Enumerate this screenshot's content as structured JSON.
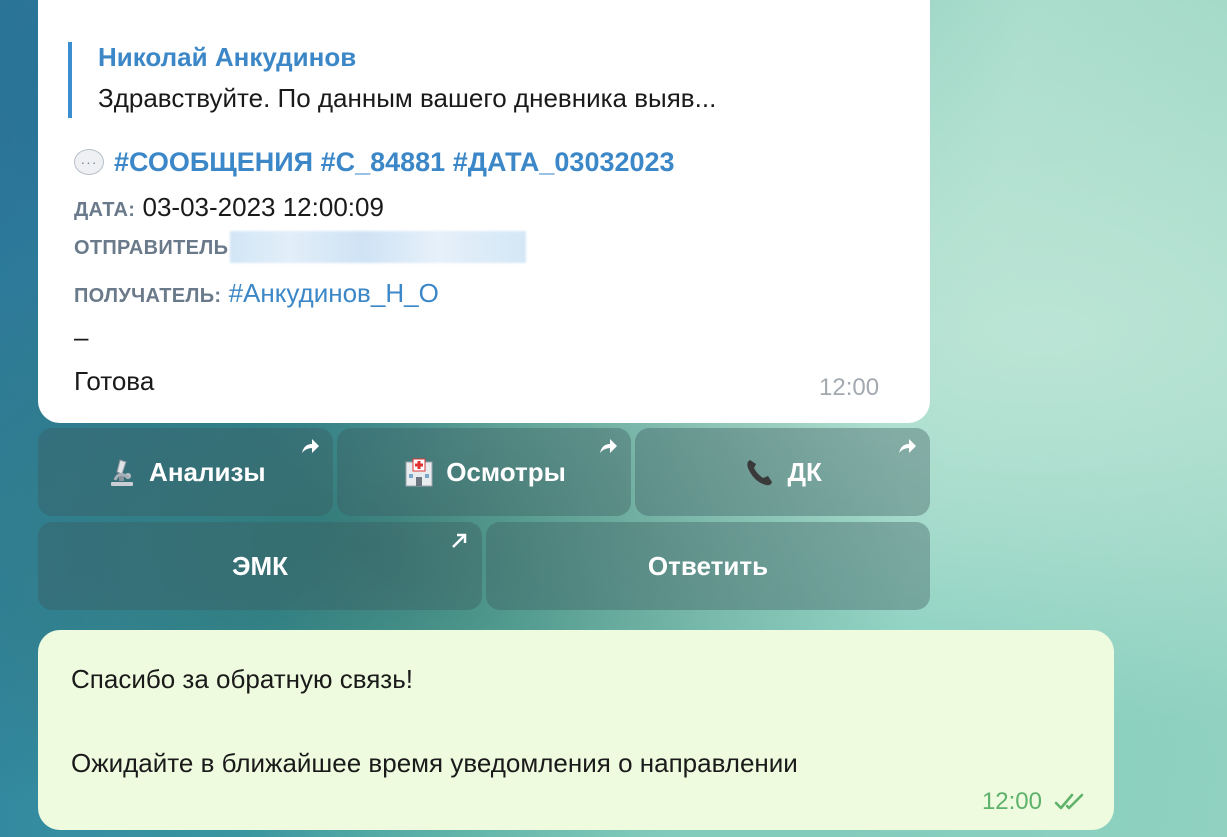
{
  "incoming_message": {
    "reply": {
      "author": "Николай Анкудинов",
      "text": "Здравствуйте. По данным вашего дневника выяв..."
    },
    "hashtags": "#СООБЩЕНИЯ #С_84881 #ДАТА_03032023",
    "fields": {
      "date_label": "ДАТА:",
      "date_value": "03-03-2023 12:00:09",
      "sender_label": "ОТПРАВИТЕЛЬ",
      "recipient_label": "ПОЛУЧАТЕЛЬ:",
      "recipient_value": "#Анкудинов_Н_О"
    },
    "separator": "–",
    "body": "Готова",
    "time": "12:00"
  },
  "keyboard": {
    "row1": [
      {
        "label": "Анализы",
        "icon": "microscope-icon"
      },
      {
        "label": "Осмотры",
        "icon": "hospital-icon"
      },
      {
        "label": "ДК",
        "icon": "telephone-icon"
      }
    ],
    "row2": [
      {
        "label": "ЭМК",
        "icon": "external-link-icon"
      },
      {
        "label": "Ответить"
      }
    ]
  },
  "outgoing_message": {
    "line1": "Спасибо за обратную связь!",
    "line2": "Ожидайте в ближайшее время уведомления о направлении",
    "time": "12:00",
    "status_icon": "double-check-icon"
  },
  "colors": {
    "link": "#3b87c7",
    "outgoing_bubble": "#eefbdf",
    "outgoing_time": "#5eb26b"
  }
}
